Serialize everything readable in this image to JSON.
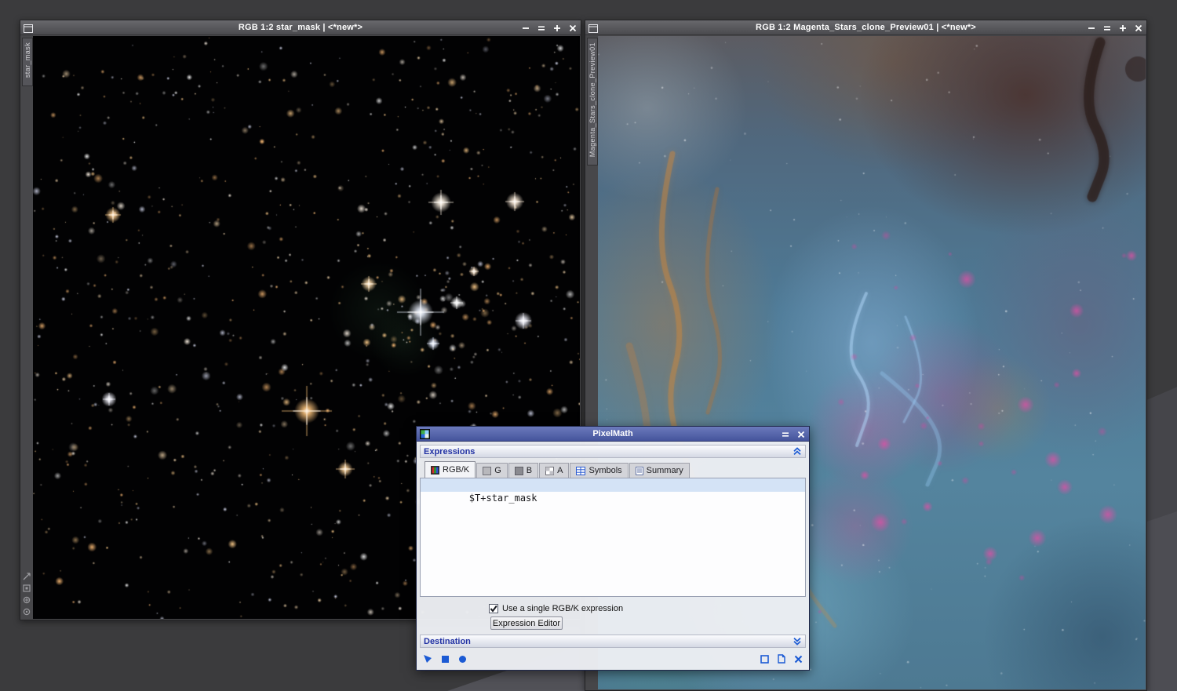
{
  "desktop": {
    "bg": "#3b3b3d"
  },
  "left_window": {
    "title": "RGB 1:2 star_mask | <*new*>",
    "tab_label": "star_mask"
  },
  "right_window": {
    "title": "RGB 1:2 Magenta_Stars_clone_Preview01 | <*new*>",
    "tab_label": "Magenta_Stars_clone_Preview01"
  },
  "pixelmath": {
    "title": "PixelMath",
    "expressions_section": "Expressions",
    "destination_section": "Destination",
    "tabs": [
      {
        "label": "RGB/K",
        "active": true
      },
      {
        "label": "G",
        "active": false
      },
      {
        "label": "B",
        "active": false
      },
      {
        "label": "A",
        "active": false
      },
      {
        "label": "Symbols",
        "active": false
      },
      {
        "label": "Summary",
        "active": false
      }
    ],
    "expression": "$T+star_mask",
    "single_rgbk_checkbox": {
      "label": "Use a single RGB/K expression",
      "checked": true
    },
    "expression_editor_button": "Expression Editor"
  },
  "colors": {
    "accent_blue": "#1b5ad4",
    "section_text": "#2232a4",
    "dialog_titlebar": "#4e5fa4"
  }
}
